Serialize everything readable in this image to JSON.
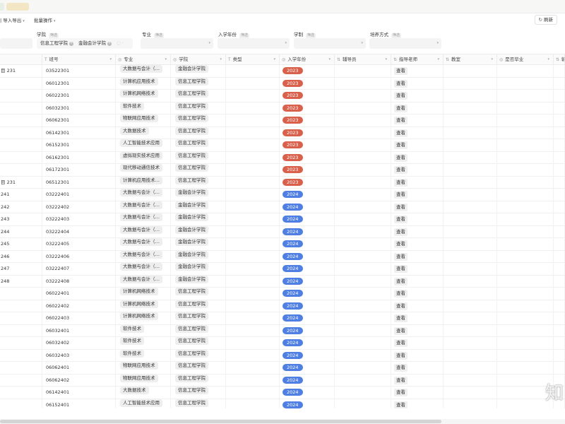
{
  "top_tabs": {
    "tab_b_label": ""
  },
  "toolbar": {
    "import_export_label": "导入导出",
    "import_export_partial": "| 导入导出",
    "batch_label": "批量操作",
    "refresh_label": "刷新"
  },
  "filters": {
    "college": {
      "label": "学院",
      "tag": "筛选",
      "values": [
        "信息工程学院",
        "金融会计学院"
      ]
    },
    "major": {
      "label": "专业",
      "tag": "筛选"
    },
    "enroll_year": {
      "label": "入学年份",
      "tag": "筛选"
    },
    "system": {
      "label": "学制",
      "tag": "筛选"
    },
    "training": {
      "label": "培养方式",
      "tag": "筛选"
    }
  },
  "columns": [
    {
      "label": "",
      "type_icon": ""
    },
    {
      "label": "班号",
      "type_icon": "T"
    },
    {
      "label": "专业",
      "type_icon": "◎"
    },
    {
      "label": "学院",
      "type_icon": "◎"
    },
    {
      "label": "类型",
      "type_icon": "T"
    },
    {
      "label": "入学年份",
      "type_icon": "◎"
    },
    {
      "label": "辅导员",
      "type_icon": "⇅"
    },
    {
      "label": "指导老师",
      "type_icon": "⇅"
    },
    {
      "label": "教室",
      "type_icon": "⇅"
    },
    {
      "label": "是否毕业",
      "type_icon": "◎"
    },
    {
      "label": "输",
      "type_icon": "⇅"
    }
  ],
  "colors": {
    "year_2023": "#d9604b",
    "year_2024": "#4f7fe2"
  },
  "rows": [
    {
      "name": "目 231",
      "code": "03522301",
      "major": "大数据与会计（…",
      "college": "金融会计学院",
      "year": "2023",
      "action": "查看"
    },
    {
      "name": "",
      "code": "06012301",
      "major": "计算机应用技术",
      "college": "信息工程学院",
      "year": "2023",
      "action": "查看"
    },
    {
      "name": "",
      "code": "06022301",
      "major": "计算机网络技术",
      "college": "信息工程学院",
      "year": "2023",
      "action": "查看"
    },
    {
      "name": "",
      "code": "06032301",
      "major": "软件技术",
      "college": "信息工程学院",
      "year": "2023",
      "action": "查看"
    },
    {
      "name": "",
      "code": "06062301",
      "major": "物联网应用技术",
      "college": "信息工程学院",
      "year": "2023",
      "action": "查看"
    },
    {
      "name": "",
      "code": "06142301",
      "major": "大数据技术",
      "college": "信息工程学院",
      "year": "2023",
      "action": "查看"
    },
    {
      "name": "",
      "code": "06152301",
      "major": "人工智能技术应用",
      "college": "信息工程学院",
      "year": "2023",
      "action": "查看"
    },
    {
      "name": "",
      "code": "06162301",
      "major": "虚拟现实技术应用",
      "college": "信息工程学院",
      "year": "2023",
      "action": "查看"
    },
    {
      "name": "",
      "code": "06172301",
      "major": "现代移动通信技术",
      "college": "信息工程学院",
      "year": "2023",
      "action": "查看"
    },
    {
      "name": "目 231",
      "code": "06512301",
      "major": "计算机应用技术…",
      "college": "信息工程学院",
      "year": "2023",
      "action": "查看"
    },
    {
      "name": "241",
      "code": "03222401",
      "major": "大数据与会计（…",
      "college": "金融会计学院",
      "year": "2024",
      "action": "查看"
    },
    {
      "name": "242",
      "code": "03222402",
      "major": "大数据与会计（…",
      "college": "金融会计学院",
      "year": "2024",
      "action": "查看"
    },
    {
      "name": "243",
      "code": "03222403",
      "major": "大数据与会计（…",
      "college": "金融会计学院",
      "year": "2024",
      "action": "查看"
    },
    {
      "name": "244",
      "code": "03222404",
      "major": "大数据与会计（…",
      "college": "金融会计学院",
      "year": "2024",
      "action": "查看"
    },
    {
      "name": "245",
      "code": "03222405",
      "major": "大数据与会计（…",
      "college": "金融会计学院",
      "year": "2024",
      "action": "查看"
    },
    {
      "name": "246",
      "code": "03222406",
      "major": "大数据与会计（…",
      "college": "金融会计学院",
      "year": "2024",
      "action": "查看"
    },
    {
      "name": "247",
      "code": "03222407",
      "major": "大数据与会计（…",
      "college": "金融会计学院",
      "year": "2024",
      "action": "查看"
    },
    {
      "name": "248",
      "code": "03222408",
      "major": "大数据与会计（…",
      "college": "金融会计学院",
      "year": "2024",
      "action": "查看"
    },
    {
      "name": "",
      "code": "06022401",
      "major": "计算机网络技术",
      "college": "信息工程学院",
      "year": "2024",
      "action": "查看"
    },
    {
      "name": "",
      "code": "06022402",
      "major": "计算机网络技术",
      "college": "信息工程学院",
      "year": "2024",
      "action": "查看"
    },
    {
      "name": "",
      "code": "06022403",
      "major": "计算机网络技术",
      "college": "信息工程学院",
      "year": "2024",
      "action": "查看"
    },
    {
      "name": "",
      "code": "06032401",
      "major": "软件技术",
      "college": "信息工程学院",
      "year": "2024",
      "action": "查看"
    },
    {
      "name": "",
      "code": "06032402",
      "major": "软件技术",
      "college": "信息工程学院",
      "year": "2024",
      "action": "查看"
    },
    {
      "name": "",
      "code": "06032403",
      "major": "软件技术",
      "college": "信息工程学院",
      "year": "2024",
      "action": "查看"
    },
    {
      "name": "",
      "code": "06062401",
      "major": "物联网应用技术",
      "college": "信息工程学院",
      "year": "2024",
      "action": "查看"
    },
    {
      "name": "",
      "code": "06062402",
      "major": "物联网应用技术",
      "college": "信息工程学院",
      "year": "2024",
      "action": "查看"
    },
    {
      "name": "",
      "code": "06142401",
      "major": "大数据技术",
      "college": "信息工程学院",
      "year": "2024",
      "action": "查看"
    },
    {
      "name": "",
      "code": "06152401",
      "major": "人工智能技术应用",
      "college": "信息工程学院",
      "year": "2024",
      "action": "查看"
    }
  ],
  "watermark": "知"
}
